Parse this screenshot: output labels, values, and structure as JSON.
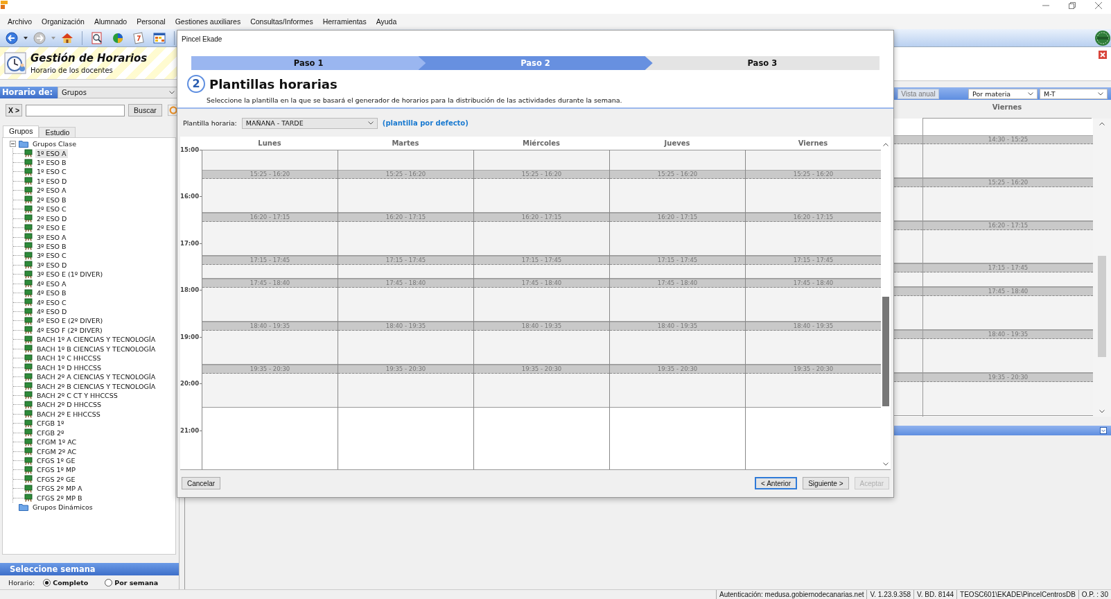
{
  "menu": [
    "Archivo",
    "Organización",
    "Alumnado",
    "Personal",
    "Gestiones auxiliares",
    "Consultas/Informes",
    "Herramientas",
    "Ayuda"
  ],
  "sidebar": {
    "title": "Gestión de Horarios",
    "subtitle": "Horario de los docentes",
    "schedule_of": {
      "label": "Horario de:",
      "value": "Grupos"
    },
    "search": {
      "clear_button": "X >",
      "button": "Buscar"
    },
    "tabs": [
      {
        "label": "Grupos",
        "selected": true
      },
      {
        "label": "Estudio",
        "selected": false
      }
    ],
    "tree": [
      {
        "label": "Grupos Clase",
        "expanded": true,
        "children": [
          {
            "label": "1º ESO A",
            "selected": true
          },
          {
            "label": "1º ESO B",
            "selected": false
          },
          {
            "label": "1º ESO C",
            "selected": false
          },
          {
            "label": "1º ESO D",
            "selected": false
          },
          {
            "label": "2º ESO A",
            "selected": false
          },
          {
            "label": "2º ESO B",
            "selected": false
          },
          {
            "label": "2º ESO C",
            "selected": false
          },
          {
            "label": "2º ESO D",
            "selected": false
          },
          {
            "label": "2º ESO E",
            "selected": false
          },
          {
            "label": "3º ESO A",
            "selected": false
          },
          {
            "label": "3º ESO B",
            "selected": false
          },
          {
            "label": "3º ESO C",
            "selected": false
          },
          {
            "label": "3º ESO D",
            "selected": false
          },
          {
            "label": "3º ESO E (1º DIVER)",
            "selected": false
          },
          {
            "label": "4º ESO A",
            "selected": false
          },
          {
            "label": "4º ESO B",
            "selected": false
          },
          {
            "label": "4º ESO C",
            "selected": false
          },
          {
            "label": "4º ESO D",
            "selected": false
          },
          {
            "label": "4º ESO E (2º DIVER)",
            "selected": false
          },
          {
            "label": "4º ESO F (2º DIVER)",
            "selected": false
          },
          {
            "label": "BACH 1º A CIENCIAS Y TECNOLOGÍA",
            "selected": false
          },
          {
            "label": "BACH 1º B CIENCIAS Y TECNOLOGÍA",
            "selected": false
          },
          {
            "label": "BACH 1º C HHCCSS",
            "selected": false
          },
          {
            "label": "BACH 1º D HHCCSS",
            "selected": false
          },
          {
            "label": "BACH 2º A CIENCIAS Y TECNOLOGÍA",
            "selected": false
          },
          {
            "label": "BACH 2º B CIENCIAS Y TECNOLOGÍA",
            "selected": false
          },
          {
            "label": "BACH 2º C CT Y HHCCSS",
            "selected": false
          },
          {
            "label": "BACH 2º D HHCCSS",
            "selected": false
          },
          {
            "label": "BACH 2º E HHCCSS",
            "selected": false
          },
          {
            "label": "CFGB 1º",
            "selected": false
          },
          {
            "label": "CFGB 2º",
            "selected": false
          },
          {
            "label": "CFGM 1º AC",
            "selected": false
          },
          {
            "label": "CFGM 2º AC",
            "selected": false
          },
          {
            "label": "CFGS 1º GE",
            "selected": false
          },
          {
            "label": "CFGS 1º MP",
            "selected": false
          },
          {
            "label": "CFGS 2º GE",
            "selected": false
          },
          {
            "label": "CFGS 2º MP A",
            "selected": false
          },
          {
            "label": "CFGS 2º MP B",
            "selected": false
          }
        ]
      },
      {
        "label": "Grupos Dinámicos"
      }
    ]
  },
  "week_panel": {
    "title": "Seleccione semana",
    "label": "Horario:",
    "options": [
      {
        "label": "Completo",
        "selected": true
      },
      {
        "label": "Por semana",
        "selected": false
      }
    ]
  },
  "background_schedule": {
    "view_button": "Vista anual",
    "filter": "Por materia",
    "shift": "M-T",
    "day": "Viernes",
    "slots": [
      "14:30 - 15:25",
      "15:25 - 16:20",
      "16:20 - 17:15",
      "17:15 - 17:45",
      "17:45 - 18:40",
      "18:40 - 19:35",
      "19:35 - 20:30"
    ]
  },
  "dialog": {
    "title": "Pincel Ekade",
    "steps": [
      {
        "label": "Paso 1",
        "done": true,
        "selected": false
      },
      {
        "label": "Paso 2",
        "done": false,
        "selected": true
      },
      {
        "label": "Paso 3",
        "done": false,
        "selected": false
      }
    ],
    "step_number": "2",
    "heading": "Plantillas horarias",
    "description": "Seleccione la plantilla en la que se basará el generador de horarios para la distribución de las actividades durante la semana.",
    "template": {
      "label": "Plantilla horaria:",
      "value": "MAÑANA - TARDE",
      "note": "(plantilla por defecto)"
    },
    "grid": {
      "hours": [
        "15:00",
        "16:00",
        "17:00",
        "18:00",
        "19:00",
        "20:00",
        "21:00"
      ],
      "days": [
        {
          "label": "Lunes",
          "slots": [
            "15:25 - 16:20",
            "16:20 - 17:15",
            "17:15 - 17:45",
            "17:45 - 18:40",
            "18:40 - 19:35",
            "19:35 - 20:30"
          ]
        },
        {
          "label": "Martes",
          "slots": [
            "15:25 - 16:20",
            "16:20 - 17:15",
            "17:15 - 17:45",
            "17:45 - 18:40",
            "18:40 - 19:35",
            "19:35 - 20:30"
          ]
        },
        {
          "label": "Miércoles",
          "slots": [
            "15:25 - 16:20",
            "16:20 - 17:15",
            "17:15 - 17:45",
            "17:45 - 18:40",
            "18:40 - 19:35",
            "19:35 - 20:30"
          ]
        },
        {
          "label": "Jueves",
          "slots": [
            "15:25 - 16:20",
            "16:20 - 17:15",
            "17:15 - 17:45",
            "17:45 - 18:40",
            "18:40 - 19:35",
            "19:35 - 20:30"
          ]
        },
        {
          "label": "Viernes",
          "slots": [
            "15:25 - 16:20",
            "16:20 - 17:15",
            "17:15 - 17:45",
            "17:45 - 18:40",
            "18:40 - 19:35",
            "19:35 - 20:30"
          ]
        }
      ]
    },
    "buttons": [
      {
        "label": "Cancelar",
        "default": false,
        "disabled": false
      },
      {
        "label": "< Anterior",
        "default": true,
        "disabled": false
      },
      {
        "label": "Siguiente >",
        "default": false,
        "disabled": false
      },
      {
        "label": "Aceptar",
        "default": false,
        "disabled": true
      }
    ]
  },
  "status_bar": [
    "Autenticación: medusa.gobiernodecanarias.net",
    "V. 1.23.9.358",
    "V. BD. 8144",
    "TEOSC601\\EKADE\\PincelCentrosDB",
    "O.P. : 30"
  ]
}
